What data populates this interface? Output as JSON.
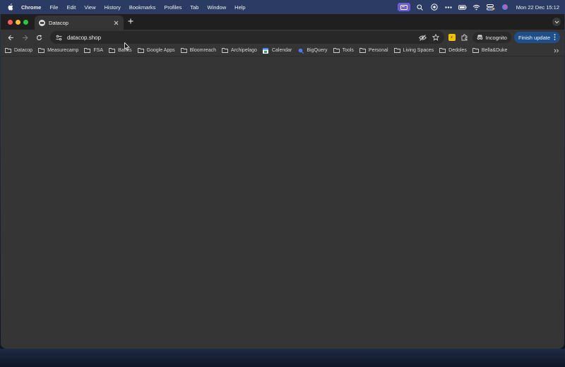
{
  "menubar": {
    "app": "Chrome",
    "items": [
      "File",
      "Edit",
      "View",
      "History",
      "Bookmarks",
      "Profiles",
      "Tab",
      "Window",
      "Help"
    ],
    "clock": "Mon 22 Dec  15:12"
  },
  "tab": {
    "title": "Datacop"
  },
  "toolbar": {
    "url": "datacop.shop",
    "incognito_label": "Incognito",
    "finish_update_label": "Finish update"
  },
  "bookmarks": [
    {
      "label": "Datacop",
      "icon": "folder-icon"
    },
    {
      "label": "Measurecamp",
      "icon": "folder-icon"
    },
    {
      "label": "FSA",
      "icon": "folder-icon"
    },
    {
      "label": "Banks",
      "icon": "folder-icon"
    },
    {
      "label": "Google Apps",
      "icon": "folder-icon"
    },
    {
      "label": "Bloomreach",
      "icon": "folder-icon"
    },
    {
      "label": "Archipelago",
      "icon": "folder-icon"
    },
    {
      "label": "Calendar",
      "icon": "calendar-icon"
    },
    {
      "label": "BigQuery",
      "icon": "bigquery-icon"
    },
    {
      "label": "Tools",
      "icon": "folder-icon"
    },
    {
      "label": "Personal",
      "icon": "folder-icon"
    },
    {
      "label": "Living Spaces",
      "icon": "folder-icon"
    },
    {
      "label": "Dedoles",
      "icon": "folder-icon"
    },
    {
      "label": "Bella&Duke",
      "icon": "folder-icon"
    }
  ],
  "colors": {
    "menubar": "#2b3b63",
    "window_bg": "#353535",
    "finish_update": "#1f4f8a",
    "record_badge": "#6e5cd6"
  }
}
